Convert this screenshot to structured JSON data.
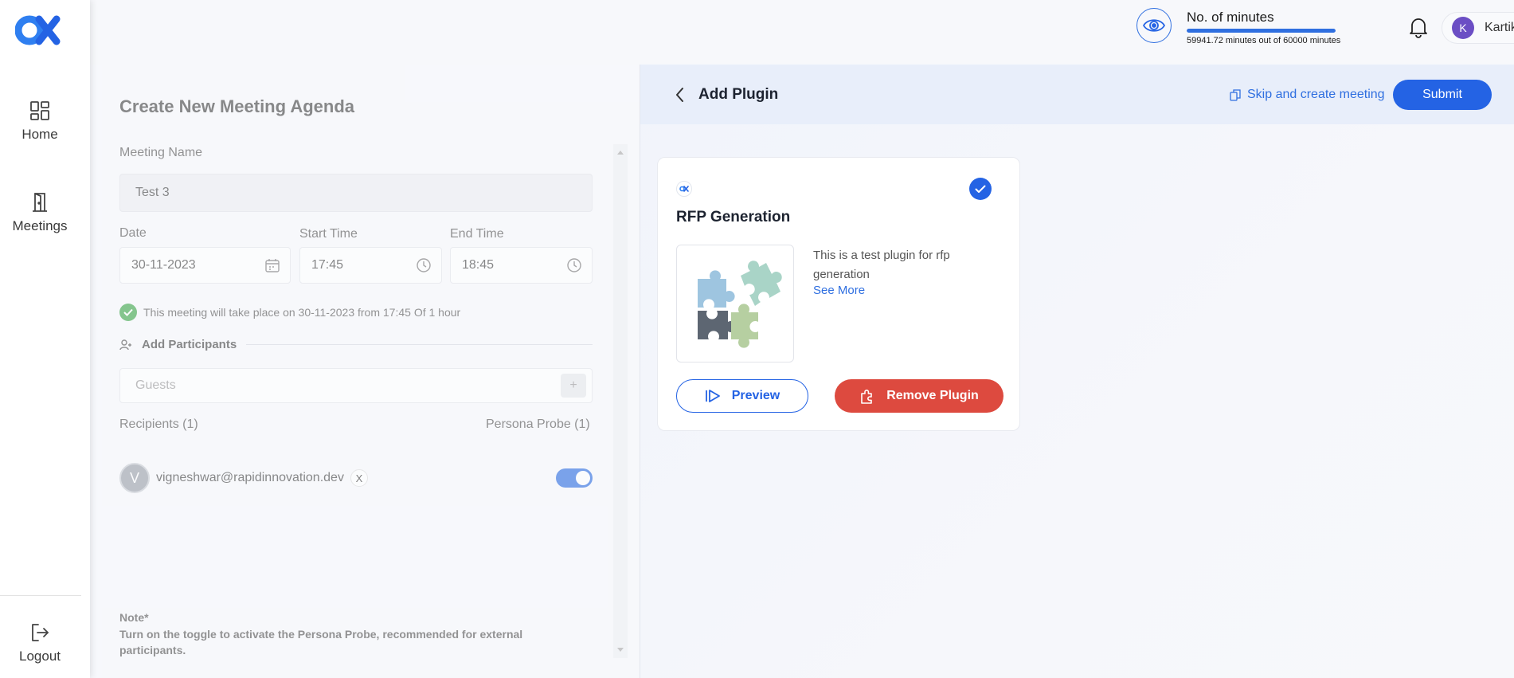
{
  "sidebar": {
    "items": [
      {
        "label": "Home",
        "icon": "grid-icon"
      },
      {
        "label": "Meetings",
        "icon": "door-icon"
      }
    ],
    "logout_label": "Logout"
  },
  "header": {
    "minutes_title": "No. of minutes",
    "minutes_sub": "59941.72 minutes out of 60000 minutes",
    "minutes_used_fraction": 0.999,
    "user_initial": "K",
    "user_name": "Kartik Behl"
  },
  "form": {
    "title": "Create New Meeting Agenda",
    "meeting_name_label": "Meeting Name",
    "meeting_name_value": "Test 3",
    "date_label": "Date",
    "date_value": "30-11-2023",
    "start_label": "Start Time",
    "start_value": "17:45",
    "end_label": "End Time",
    "end_value": "18:45",
    "schedule_note": "This meeting will take place on 30-11-2023 from 17:45 Of 1 hour",
    "participants_label": "Add Participants",
    "guests_placeholder": "Guests",
    "plus_label": "+",
    "recipients_label": "Recipients (1)",
    "persona_label": "Persona Probe (1)",
    "recipient": {
      "initial": "V",
      "email": "vigneshwar@rapidinnovation.dev",
      "remove_label": "X",
      "persona_on": true
    },
    "note_title": "Note*",
    "note_text": "Turn on the toggle to activate the Persona Probe, recommended for external participants."
  },
  "plugin_panel": {
    "title": "Add Plugin",
    "skip_label": "Skip and create meeting",
    "submit_label": "Submit",
    "card": {
      "title": "RFP Generation",
      "description": "This is a test plugin for rfp generation",
      "see_more": "See More",
      "preview_label": "Preview",
      "remove_label": "Remove Plugin",
      "selected": true
    }
  },
  "colors": {
    "accent": "#2463e4",
    "danger": "#dd4a3f",
    "success": "#3fa64a",
    "avatar": "#6b4ec4"
  }
}
